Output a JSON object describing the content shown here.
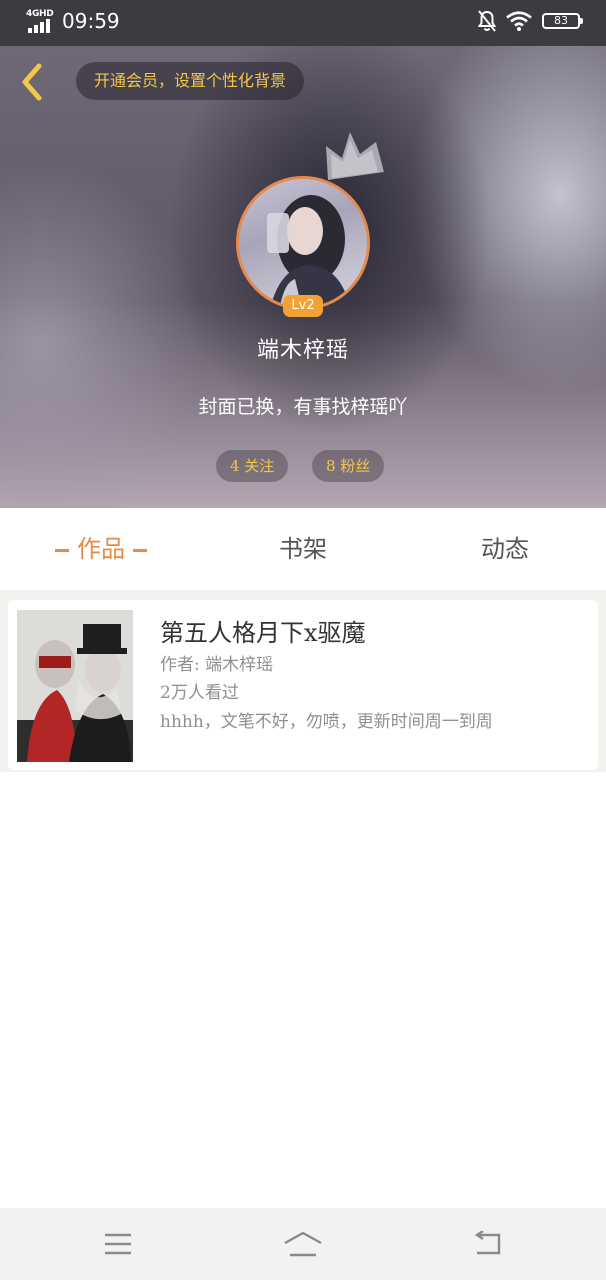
{
  "status_bar": {
    "network": "4GHD",
    "time": "09:59",
    "battery": "83",
    "icons": [
      "signal-icon",
      "mute-bell-icon",
      "wifi-icon",
      "battery-icon"
    ]
  },
  "header": {
    "back_icon": "chevron-left-icon",
    "vip_banner": "开通会员，设置个性化背景",
    "crown_icon": "crown-icon",
    "level": "Lv2",
    "username": "端木梓瑶",
    "signature": "封面已换，有事找梓瑶吖",
    "following": "4 关注",
    "fans": "8 粉丝"
  },
  "tabs": [
    {
      "label": "作品",
      "active": true
    },
    {
      "label": "书架",
      "active": false
    },
    {
      "label": "动态",
      "active": false
    }
  ],
  "book": {
    "title": "第五人格月下x驱魔",
    "author": "作者: 端木梓瑶",
    "views": "2万人看过",
    "description": "hhhh，文笔不好，勿喷，更新时间周一到周"
  },
  "nav_bar": {
    "icons": [
      "menu-icon",
      "home-icon",
      "back-icon"
    ]
  },
  "colors": {
    "accent": "#e88b45",
    "gold_text": "#f3c74a",
    "level_badge": "#f2a233",
    "status_bar": "#3b3b40",
    "nav_bar": "#f2f2f2"
  }
}
